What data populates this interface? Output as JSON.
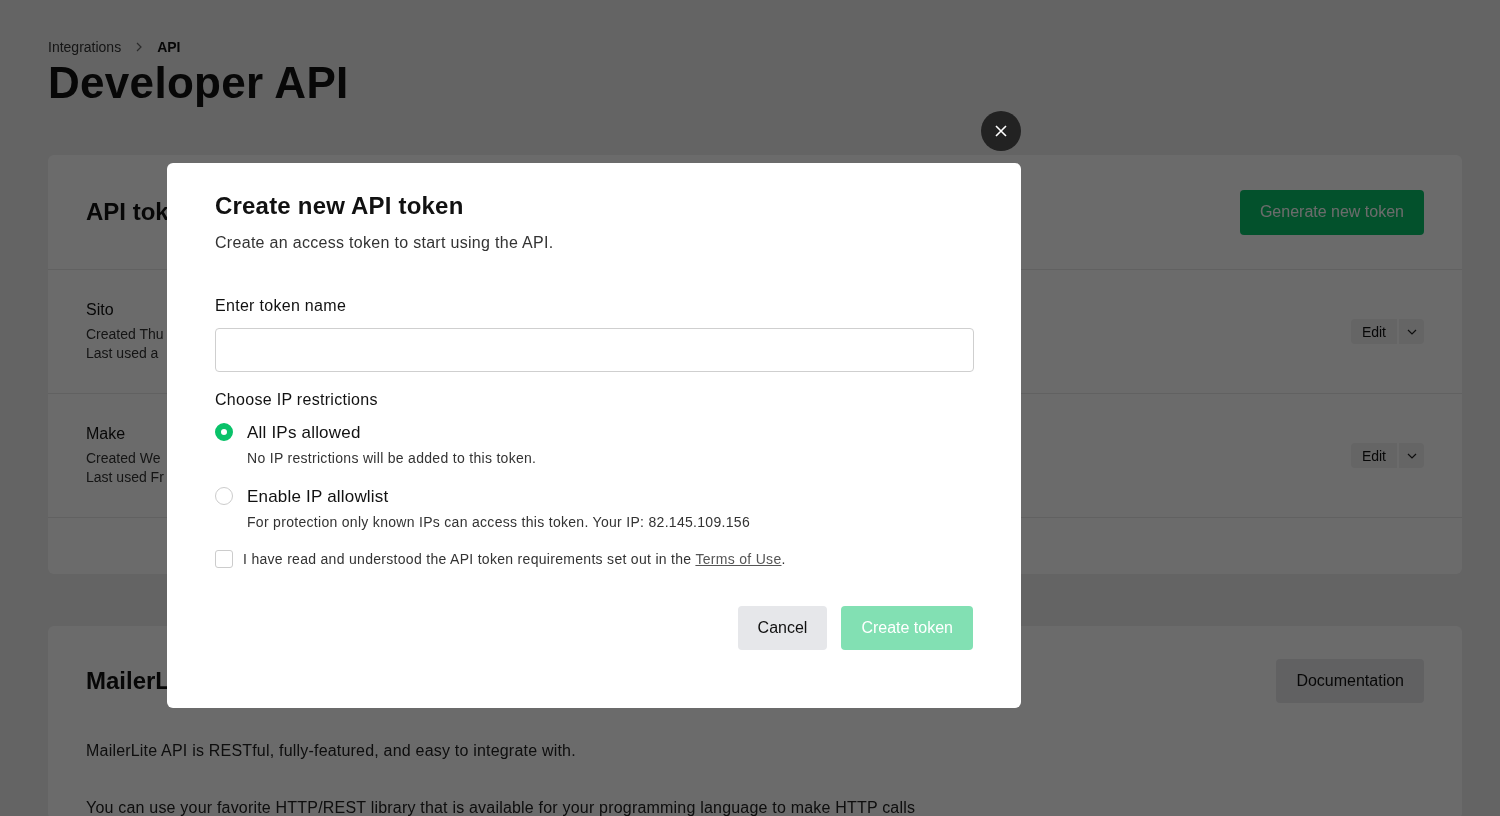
{
  "breadcrumb": [
    {
      "label": "Integrations"
    },
    {
      "label": "API"
    }
  ],
  "page_title": "Developer API",
  "tokens_card": {
    "title": "API tok",
    "generate_button": "Generate new token",
    "tokens": [
      {
        "name": "Sito",
        "created": "Created Thu",
        "last_used": "Last used a",
        "edit_button": "Edit"
      },
      {
        "name": "Make",
        "created": "Created We",
        "last_used": "Last used Fr",
        "edit_button": "Edit"
      }
    ]
  },
  "api_card": {
    "title": "MailerL",
    "documentation_button": "Documentation",
    "paragraphs": [
      "MailerLite API is RESTful, fully-featured, and easy to integrate with.",
      "You can use your favorite HTTP/REST library that is available for your programming language to make HTTP calls"
    ]
  },
  "dialog": {
    "title": "Create new API token",
    "subtitle": "Create an access token to start using the API.",
    "name_label": "Enter token name",
    "ip_label": "Choose IP restrictions",
    "ip_options": [
      {
        "label": "All IPs allowed",
        "description": "No IP restrictions will be added to this token.",
        "selected": true
      },
      {
        "label": "Enable IP allowlist",
        "description": "For protection only known IPs can access this token. Your IP: 82.145.109.156",
        "selected": false
      }
    ],
    "terms": {
      "checked": false,
      "text": "I have read and understood the API token requirements set out in the ",
      "link": "Terms of Use",
      "after": "."
    },
    "buttons": [
      {
        "label": "Cancel",
        "kind": "secondary",
        "disabled": false
      },
      {
        "label": "Create token",
        "kind": "primary",
        "disabled": true
      }
    ]
  }
}
